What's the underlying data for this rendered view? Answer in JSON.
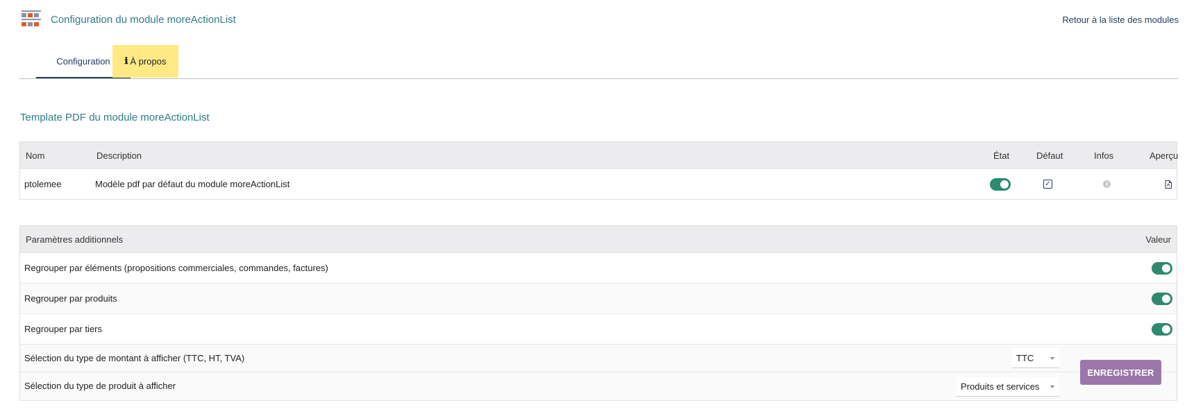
{
  "header": {
    "title": "Configuration du module moreActionList",
    "back_link": "Retour à la liste des modules"
  },
  "tabs": [
    {
      "label": "Configuration",
      "active": true
    },
    {
      "label": "À propos",
      "icon": "info-icon",
      "active": false
    }
  ],
  "templates_section": {
    "title": "Template PDF du module moreActionList",
    "columns": {
      "name": "Nom",
      "description": "Description",
      "state": "État",
      "default": "Défaut",
      "infos": "Infos",
      "preview": "Aperçu"
    },
    "rows": [
      {
        "name": "ptolemee",
        "description": "Modèle pdf par défaut du module moreActionList",
        "state_enabled": true,
        "is_default": true,
        "infos_icon": "info-icon",
        "preview_icon": "pdf-file-icon"
      }
    ]
  },
  "params_section": {
    "columns": {
      "param": "Paramètres additionnels",
      "value": "Valeur"
    },
    "toggle_rows": [
      {
        "label": "Regrouper par éléments (propositions commerciales, commandes, factures)",
        "enabled": true
      },
      {
        "label": "Regrouper par produits",
        "enabled": true
      },
      {
        "label": "Regrouper par tiers",
        "enabled": true
      }
    ],
    "select_rows": [
      {
        "label": "Sélection du type de montant à afficher (TTC, HT, TVA)",
        "value": "TTC"
      },
      {
        "label": "Sélection du type de produit à afficher",
        "value": "Produits et services"
      }
    ],
    "save_label": "ENREGISTRER"
  },
  "colors": {
    "accent_teal": "#2f7c85",
    "toggle_on": "#2d8a6e",
    "save_button": "#9b77a9",
    "about_tab_bg": "#ffe985",
    "nav_text": "#263c5c"
  }
}
